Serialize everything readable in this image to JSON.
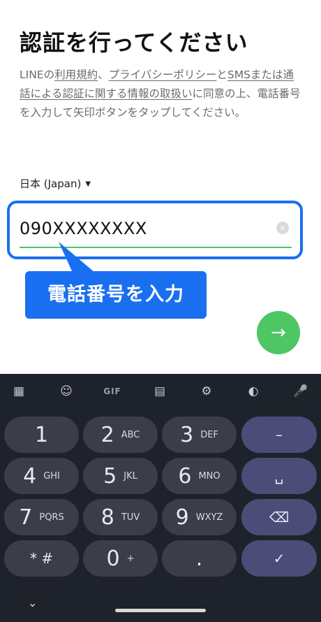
{
  "header": {
    "title": "認証を行ってください"
  },
  "description": {
    "part1": "LINEの",
    "link_terms": "利用規約",
    "sep": "、",
    "link_privacy": "プライバシーポリシー",
    "and": "と",
    "link_sms": "SMSまたは通話による認証に関する情報の取扱い",
    "part2": "に同意の上、電話番号を入力して矢印ボタンをタップしてください。"
  },
  "country": {
    "label": "日本 (Japan)",
    "arrow": "▼"
  },
  "phone": {
    "value": "090XXXXXXXX",
    "clear_icon": "×"
  },
  "callout": {
    "text": "電話番号を入力"
  },
  "next_button": {
    "glyph": "→"
  },
  "keyboard": {
    "toolbar": {
      "apps_icon": "▦",
      "sticker_icon": "☺",
      "gif_label": "GIF",
      "clipboard_icon": "▤",
      "settings_icon": "⚙",
      "palette_icon": "◐",
      "mic_icon": "🎤"
    },
    "keys": [
      {
        "num": "1",
        "letters": ""
      },
      {
        "num": "2",
        "letters": "ABC"
      },
      {
        "num": "3",
        "letters": "DEF"
      },
      {
        "num": "4",
        "letters": "GHI"
      },
      {
        "num": "5",
        "letters": "JKL"
      },
      {
        "num": "6",
        "letters": "MNO"
      },
      {
        "num": "7",
        "letters": "PQRS"
      },
      {
        "num": "8",
        "letters": "TUV"
      },
      {
        "num": "9",
        "letters": "WXYZ"
      },
      {
        "num": "* #",
        "letters": ""
      },
      {
        "num": "0",
        "letters": "+"
      },
      {
        "num": ".",
        "letters": ""
      }
    ],
    "fn_keys": {
      "minus": "–",
      "space": "␣",
      "backspace": "⌫",
      "done": "✓"
    },
    "collapse_icon": "⌄"
  },
  "colors": {
    "brand_green": "#4cc764",
    "highlight_blue": "#1a6ff0",
    "keyboard_bg": "#1e222b"
  }
}
